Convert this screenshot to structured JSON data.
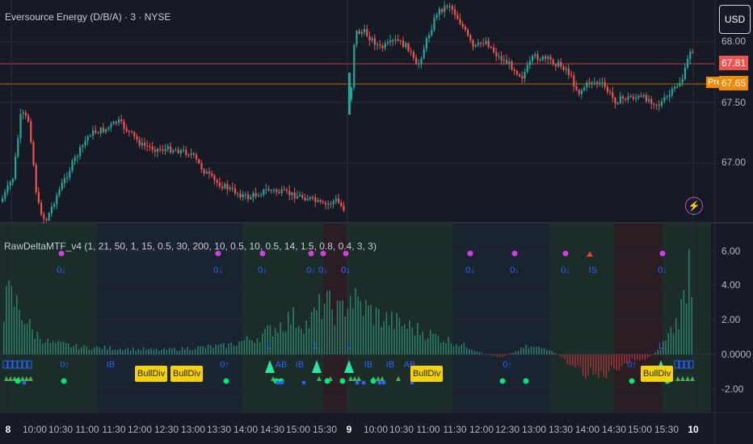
{
  "header": {
    "title": "Eversource Energy (D/B/A) · 3 · NYSE",
    "currency_button": "USD"
  },
  "indicator": {
    "title": "RawDeltaMTF_v4 (1, 21, 50, 1, 15, 0.5, 30, 200, 10, 0.5, 10, 0.5, 14, 1.5, 0.8, 0.4, 3, 3)"
  },
  "price_axis": {
    "ticks": [
      "68.00",
      "67.50",
      "67.00"
    ],
    "last_price": "67.81",
    "pre_label": "Pre",
    "pre_price": "67.65"
  },
  "indicator_axis": {
    "ticks": [
      "6.00",
      "4.00",
      "2.00",
      "0.0000",
      "-2.00"
    ]
  },
  "time_axis": {
    "ticks": [
      "8",
      "10:00",
      "10:30",
      "11:00",
      "11:30",
      "12:00",
      "12:30",
      "13:00",
      "13:30",
      "14:00",
      "14:30",
      "15:00",
      "15:30",
      "9",
      "10:00",
      "10:30",
      "11:00",
      "11:30",
      "12:00",
      "12:30",
      "13:00",
      "13:30",
      "14:00",
      "14:30",
      "15:00",
      "15:30",
      "10"
    ]
  },
  "signals": {
    "bulldiv_label": "BullDiv",
    "down_label": "0↓",
    "up_label": "0↑",
    "ib_label": "IB",
    "is_label": "IS",
    "l_label": "L",
    "ab_label": "AB"
  },
  "colors": {
    "background": "#161a25",
    "up_candle": "#26a69a",
    "down_candle": "#ef5350",
    "last_price_line": "#ef5350",
    "pre_line": "#f08a00",
    "bulldiv": "#f5d200",
    "magenta_dot": "#d040e0",
    "blue_label": "#2962ff",
    "green_dot": "#00e676"
  },
  "icons": [
    "lightning-icon"
  ]
}
